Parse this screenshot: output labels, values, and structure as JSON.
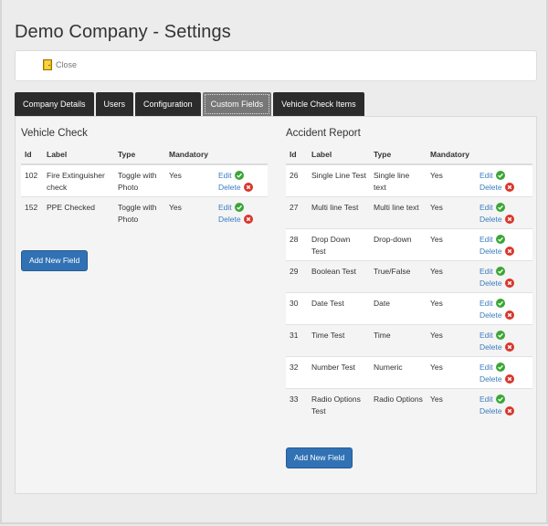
{
  "page": {
    "title": "Demo Company - Settings"
  },
  "toolbar": {
    "close_label": "Close"
  },
  "tabs": [
    {
      "label": "Company Details"
    },
    {
      "label": "Users"
    },
    {
      "label": "Configuration"
    },
    {
      "label": "Custom Fields",
      "active": true
    },
    {
      "label": "Vehicle Check Items"
    }
  ],
  "vehicle_check": {
    "title": "Vehicle Check",
    "headers": {
      "id": "Id",
      "label": "Label",
      "type": "Type",
      "mandatory": "Mandatory"
    },
    "rows": [
      {
        "id": "102",
        "label": "Fire Extinguisher check",
        "type": "Toggle with Photo",
        "mandatory": "Yes",
        "edit": "Edit",
        "delete": "Delete"
      },
      {
        "id": "152",
        "label": "PPE Checked",
        "type": "Toggle with Photo",
        "mandatory": "Yes",
        "edit": "Edit",
        "delete": "Delete"
      }
    ],
    "add_button": "Add New Field"
  },
  "accident_report": {
    "title": "Accident Report",
    "headers": {
      "id": "Id",
      "label": "Label",
      "type": "Type",
      "mandatory": "Mandatory"
    },
    "rows": [
      {
        "id": "26",
        "label": "Single Line Test",
        "type": "Single line text",
        "mandatory": "Yes",
        "edit": "Edit",
        "delete": "Delete"
      },
      {
        "id": "27",
        "label": "Multi line Test",
        "type": "Multi line text",
        "mandatory": "Yes",
        "edit": "Edit",
        "delete": "Delete"
      },
      {
        "id": "28",
        "label": "Drop Down Test",
        "type": "Drop-down",
        "mandatory": "Yes",
        "edit": "Edit",
        "delete": "Delete"
      },
      {
        "id": "29",
        "label": "Boolean Test",
        "type": "True/False",
        "mandatory": "Yes",
        "edit": "Edit",
        "delete": "Delete"
      },
      {
        "id": "30",
        "label": "Date Test",
        "type": "Date",
        "mandatory": "Yes",
        "edit": "Edit",
        "delete": "Delete"
      },
      {
        "id": "31",
        "label": "Time Test",
        "type": "Time",
        "mandatory": "Yes",
        "edit": "Edit",
        "delete": "Delete"
      },
      {
        "id": "32",
        "label": "Number Test",
        "type": "Numeric",
        "mandatory": "Yes",
        "edit": "Edit",
        "delete": "Delete"
      },
      {
        "id": "33",
        "label": "Radio Options Test",
        "type": "Radio Options",
        "mandatory": "Yes",
        "edit": "Edit",
        "delete": "Delete"
      }
    ],
    "add_button": "Add New Field"
  },
  "icons": {
    "close": "door-icon",
    "edit": "check-circle-icon",
    "delete": "x-circle-icon"
  },
  "colors": {
    "tab_bg": "#2b2b2b",
    "tab_active_bg": "#777777",
    "link": "#3a7dc1",
    "button": "#3172b5",
    "edit_icon": "#3aa635",
    "delete_icon": "#d9362b"
  }
}
